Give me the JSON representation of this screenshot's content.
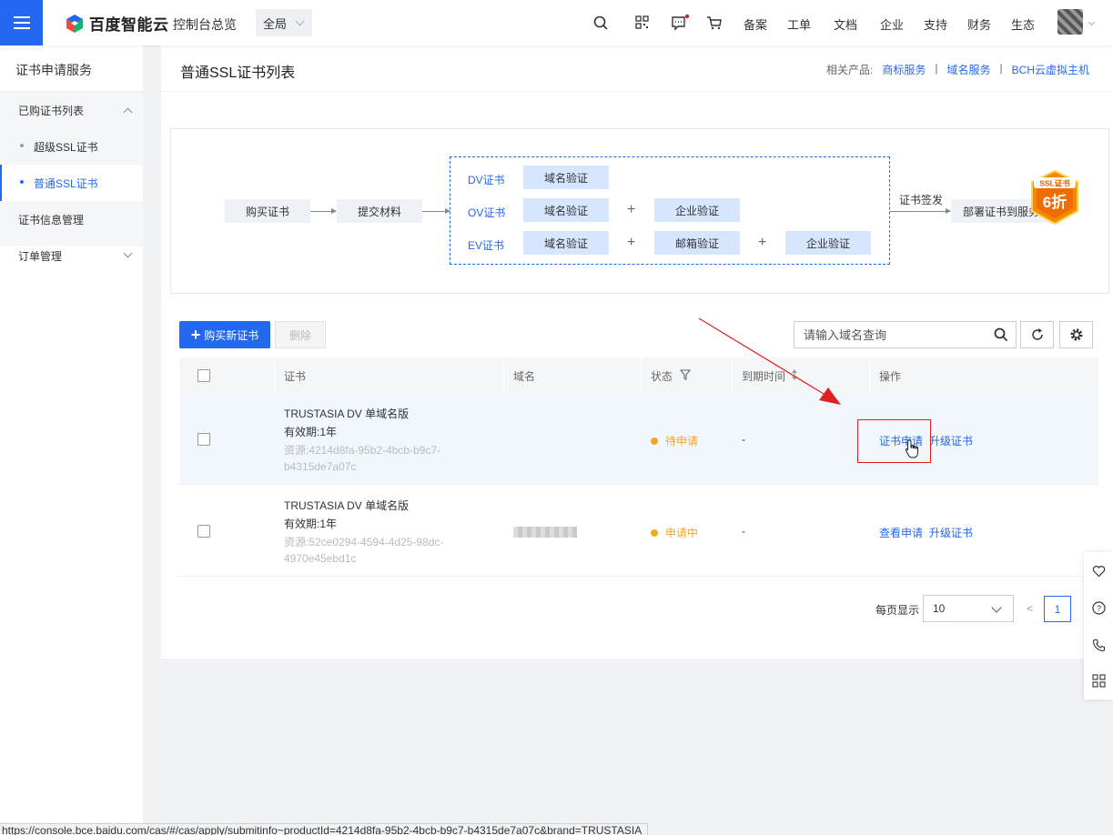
{
  "header": {
    "logo_text": "百度智能云",
    "console_link": "控制台总览",
    "region": "全局",
    "nav": [
      "备案",
      "工单",
      "文档",
      "企业",
      "支持",
      "财务",
      "生态"
    ]
  },
  "sidebar": {
    "title": "证书申请服务",
    "group": "已购证书列表",
    "sub_items": [
      "超级SSL证书",
      "普通SSL证书"
    ],
    "items": [
      "证书信息管理",
      "订单管理"
    ]
  },
  "page": {
    "title": "普通SSL证书列表",
    "related_label": "相关产品:",
    "related_links": [
      "商标服务",
      "域名服务",
      "BCH云虚拟主机"
    ],
    "related_sep": "|"
  },
  "flow": {
    "buy": "购买证书",
    "submit": "提交材料",
    "dv": "DV证书",
    "ov": "OV证书",
    "ev": "EV证书",
    "domain_verify": "域名验证",
    "enterprise_verify": "企业验证",
    "email_verify": "邮箱验证",
    "plus": "+",
    "issue": "证书签发",
    "deploy": "部署证书到服务",
    "promo_top": "SSL证书",
    "promo_main": "6折"
  },
  "toolbar": {
    "buy_new": "购买新证书",
    "delete": "删除",
    "search_placeholder": "请输入域名查询"
  },
  "table": {
    "headers": [
      "证书",
      "域名",
      "状态",
      "到期时间",
      "操作"
    ],
    "rows": [
      {
        "name": "TRUSTASIA DV 单域名版",
        "validity": "有效期:1年",
        "resource_1": "资源:4214d8fa-95b2-4bcb-b9c7-",
        "resource_2": "b4315de7a07c",
        "status": "待申请",
        "expiry": "-",
        "action_1": "证书申请",
        "action_2": "升级证书"
      },
      {
        "name": "TRUSTASIA DV 单域名版",
        "validity": "有效期:1年",
        "resource_1": "资源:52ce0294-4594-4d25-98dc-",
        "resource_2": "4970e45ebd1c",
        "status": "申请中",
        "expiry": "-",
        "action_1": "查看申请",
        "action_2": "升级证书"
      }
    ]
  },
  "pagination": {
    "page_size_label": "每页显示",
    "page_size": "10",
    "prev": "<",
    "current_page": "1"
  },
  "status_bar": {
    "url": "https://console.bce.baidu.com/cas/#/cas/apply/submitinfo~productId=4214d8fa-95b2-4bcb-b9c7-b4315de7a07c&brand=TRUSTASIA"
  },
  "colors": {
    "primary": "#2468f2",
    "pending": "#f5a623",
    "annotation": "#e02020"
  }
}
